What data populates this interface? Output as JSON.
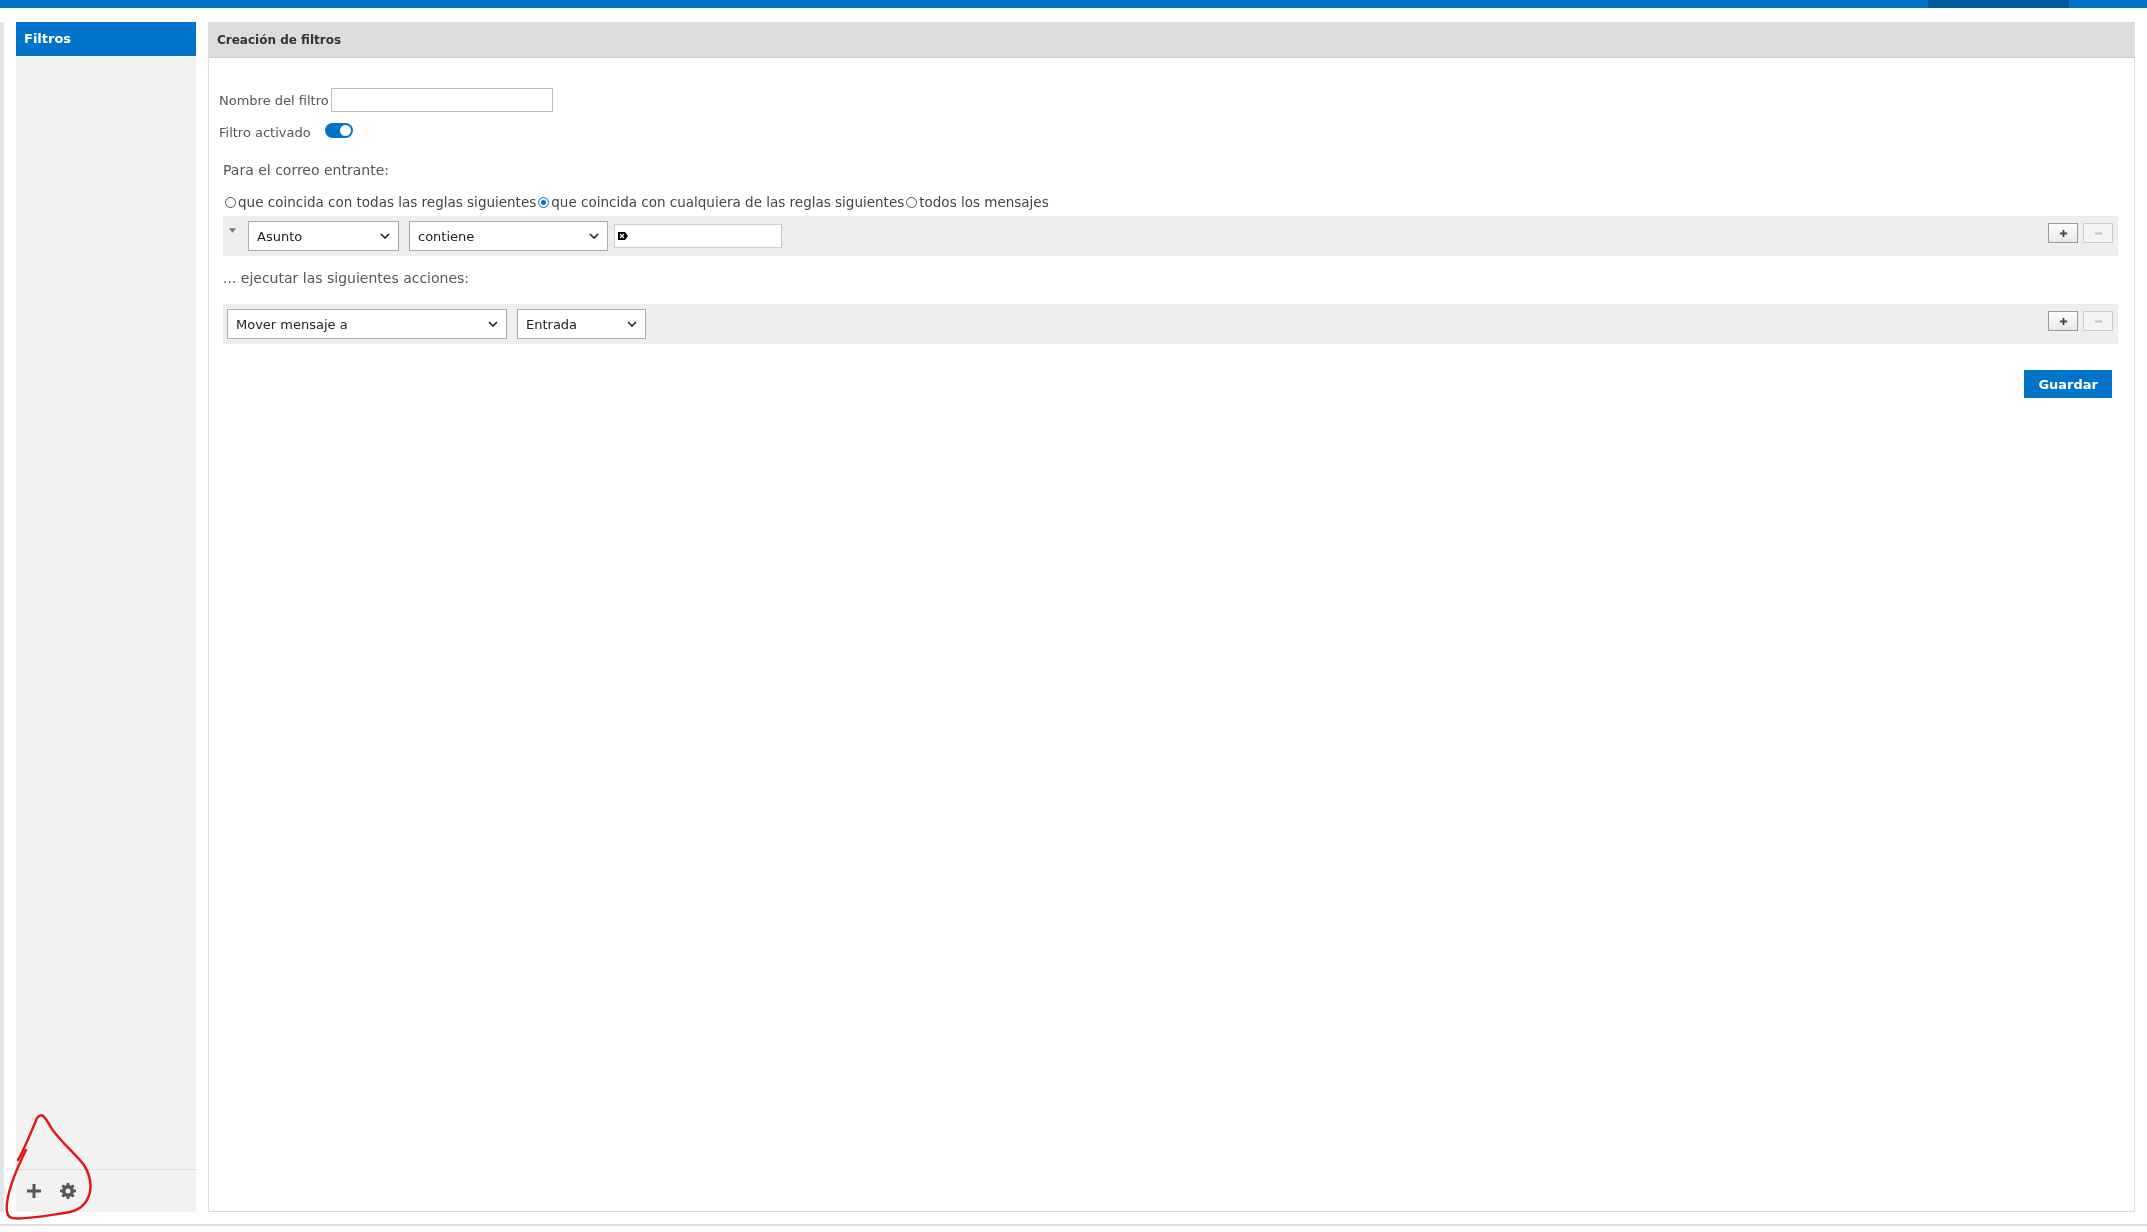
{
  "sidebar": {
    "items": [
      {
        "label": "Filtros",
        "selected": true
      }
    ]
  },
  "panel": {
    "title": "Creación de filtros",
    "name_field": {
      "label": "Nombre del filtro"
    },
    "enabled_toggle": {
      "label": "Filtro activado",
      "on": true
    },
    "incoming_label": "Para el correo entrante:",
    "match_options": [
      {
        "label": "que coincida con todas las reglas siguientes",
        "selected": false
      },
      {
        "label": "que coincida con cualquiera de las reglas siguientes",
        "selected": true
      },
      {
        "label": "todos los mensajes",
        "selected": false
      }
    ],
    "rules": [
      {
        "expanded": false,
        "field": "Asunto",
        "operator": "contiene",
        "add_disabled": false,
        "remove_disabled": true
      }
    ],
    "actions_label": "... ejecutar las siguientes acciones:",
    "actions": [
      {
        "action": "Mover mensaje a",
        "target": "Entrada",
        "add_disabled": false,
        "remove_disabled": true
      }
    ],
    "save_button": "Guardar"
  }
}
